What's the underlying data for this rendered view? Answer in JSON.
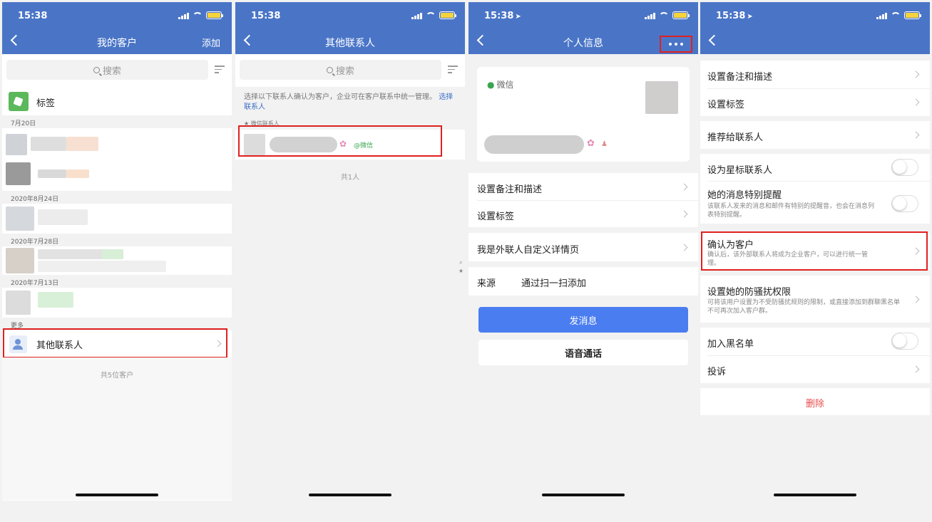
{
  "status": {
    "time": "15:38"
  },
  "screen1": {
    "title": "我的客户",
    "add": "添加",
    "search_placeholder": "搜索",
    "tags_label": "标签",
    "date1": "7月20日",
    "date2": "2020年8月24日",
    "date3": "2020年7月28日",
    "date4": "2020年7月13日",
    "more": "更多",
    "other_contacts": "其他联系人",
    "count": "共5位客户"
  },
  "screen2": {
    "title": "其他联系人",
    "search_placeholder": "搜索",
    "hint": "选择以下联系人确认为客户，企业可在客户联系中统一管理。",
    "hint_link": "选择联系人",
    "section": "★ 微信联系人",
    "wx_tag": "@微信",
    "count": "共1人"
  },
  "screen3": {
    "title": "个人信息",
    "wechat": "微信",
    "menu": [
      "设置备注和描述",
      "设置标签",
      "我是外联人自定义详情页"
    ],
    "source_label": "来源",
    "source_value": "通过扫一扫添加",
    "send": "发消息",
    "voice": "语音通话"
  },
  "screen4": {
    "items": {
      "remark": "设置备注和描述",
      "tags": "设置标签",
      "recommend": "推荐给联系人",
      "star": "设为星标联系人",
      "notify": "她的消息特别提醒",
      "notify_sub": "该联系人发来的消息和邮件有特别的提醒音，也会在消息列表特别提醒。",
      "confirm": "确认为客户",
      "confirm_sub": "确认后，该外部联系人将成为企业客户，可以进行统一管理。",
      "harass": "设置她的防骚扰权限",
      "harass_sub": "可将该用户设置为不受防骚扰规则的限制，或直接添加到群聊黑名单不可再次加入客户群。",
      "blacklist": "加入黑名单",
      "report": "投诉",
      "delete": "删除"
    }
  },
  "colors": {
    "header": "#4a75c7",
    "highlight": "#e02020",
    "primary": "#4a7ef0",
    "danger": "#e84c4c"
  }
}
